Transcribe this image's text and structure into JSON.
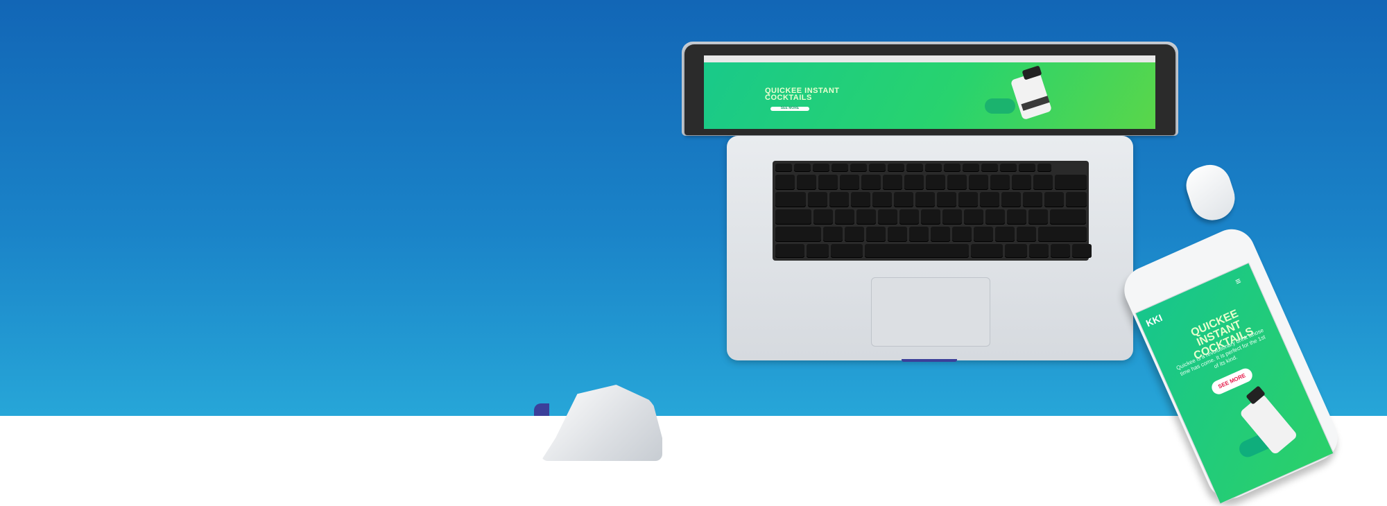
{
  "colors": {
    "background_top": "#1266b6",
    "background_bottom": "#27a6d8",
    "site_green": "#19c98a",
    "site_title": "#eaffd0",
    "phone_button_text": "#e5194a"
  },
  "laptop_site": {
    "title_line1": "QUICKEE INSTANT",
    "title_line2": "COCKTAILS",
    "button_label": "SEE MORE"
  },
  "phone_site": {
    "logo": "KKI",
    "menu_icon": "≡",
    "title_line1": "QUICKEE INSTANT",
    "title_line2": "COCKTAILS",
    "body": "Quickee is a revolutionary drink whose time has come. It is perfect for the 1st of its kind.",
    "button_label": "SEE MORE"
  }
}
